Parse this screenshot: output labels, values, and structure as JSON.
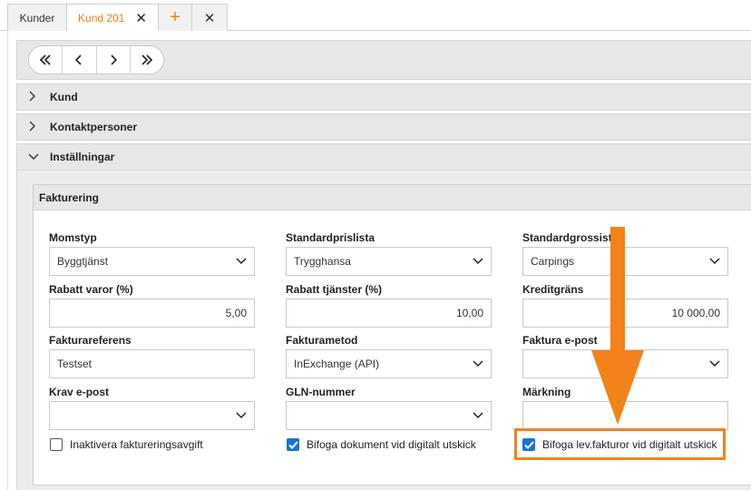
{
  "tabs": [
    {
      "label": "Kunder"
    },
    {
      "label": "Kund 201",
      "close": "✕"
    },
    {
      "label": "+"
    },
    {
      "label": "✕"
    }
  ],
  "nav": {
    "first": "«",
    "prev": "‹",
    "next": "›",
    "last": "»"
  },
  "sections": {
    "kund": "Kund",
    "kontaktpersoner": "Kontaktpersoner",
    "installningar": "Inställningar"
  },
  "fakturering": {
    "title": "Fakturering",
    "momstyp": {
      "label": "Momstyp",
      "value": "Byggtjänst"
    },
    "standardprislista": {
      "label": "Standardprislista",
      "value": "Trygghansa"
    },
    "standardgrossist": {
      "label": "Standardgrossist",
      "value": "Carpings"
    },
    "rabatt_varor": {
      "label": "Rabatt varor (%)",
      "value": "5,00"
    },
    "rabatt_tjanster": {
      "label": "Rabatt tjänster (%)",
      "value": "10,00"
    },
    "kreditgrans": {
      "label": "Kreditgräns",
      "value": "10 000,00"
    },
    "fakturareferens": {
      "label": "Fakturareferens",
      "value": "Testset"
    },
    "fakturametod": {
      "label": "Fakturametod",
      "value": "InExchange (API)"
    },
    "faktura_epost": {
      "label": "Faktura e-post",
      "value": ""
    },
    "krav_epost": {
      "label": "Krav e-post",
      "value": ""
    },
    "gln_nummer": {
      "label": "GLN-nummer",
      "value": ""
    },
    "markning": {
      "label": "Märkning",
      "value": ""
    },
    "checkboxes": [
      {
        "label": "Inaktivera faktureringsavgift",
        "checked": false
      },
      {
        "label": "Bifoga dokument vid digitalt utskick",
        "checked": true
      },
      {
        "label": "Bifoga lev.fakturor vid digitalt utskick",
        "checked": true
      }
    ]
  },
  "colors": {
    "accent": "#f28219",
    "check": "#1a73d9"
  }
}
